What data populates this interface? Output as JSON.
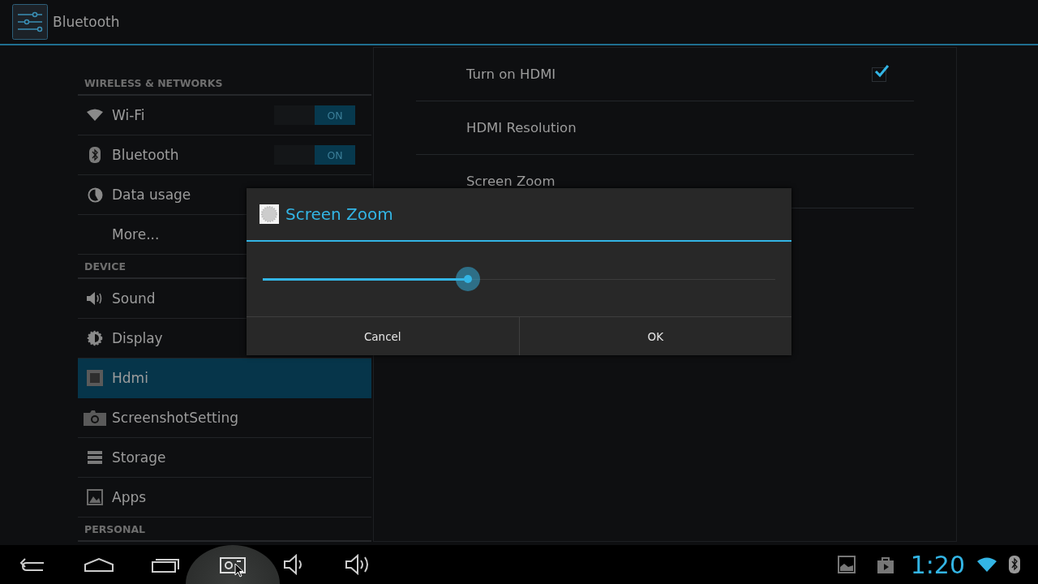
{
  "action_bar": {
    "title": "Bluetooth"
  },
  "sidebar": {
    "items": [
      {
        "kind": "header",
        "label": "WIRELESS & NETWORKS"
      },
      {
        "kind": "item",
        "label": "Wi-Fi",
        "selected": false,
        "toggle": {
          "label": "ON",
          "on": true
        }
      },
      {
        "kind": "item",
        "label": "Bluetooth",
        "selected": false,
        "toggle": {
          "label": "ON",
          "on": true
        }
      },
      {
        "kind": "item",
        "label": "Data usage",
        "selected": false
      },
      {
        "kind": "item",
        "label": "More...",
        "selected": false
      },
      {
        "kind": "header",
        "label": "DEVICE"
      },
      {
        "kind": "item",
        "label": "Sound",
        "selected": false
      },
      {
        "kind": "item",
        "label": "Display",
        "selected": false
      },
      {
        "kind": "item",
        "label": "Hdmi",
        "selected": true
      },
      {
        "kind": "item",
        "label": "ScreenshotSetting",
        "selected": false
      },
      {
        "kind": "item",
        "label": "Storage",
        "selected": false
      },
      {
        "kind": "item",
        "label": "Apps",
        "selected": false
      },
      {
        "kind": "header",
        "label": "PERSONAL"
      }
    ]
  },
  "settings": [
    {
      "label": "Turn on HDMI",
      "checked": true
    },
    {
      "label": "HDMI Resolution"
    },
    {
      "label": "Screen Zoom"
    }
  ],
  "dialog": {
    "title": "Screen Zoom",
    "slider": {
      "level": 0.4
    },
    "buttons": [
      "Cancel",
      "OK"
    ]
  },
  "status_bar": {
    "time": "1:20"
  }
}
